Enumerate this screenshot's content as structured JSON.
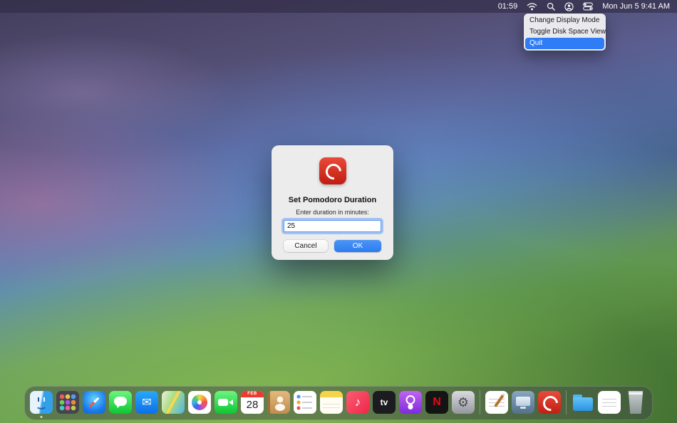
{
  "menu_bar": {
    "timer": "01:59",
    "clock": "Mon Jun 5  9:41 AM",
    "icons": [
      "wifi",
      "spotlight",
      "user-account",
      "control-center"
    ]
  },
  "dropdown_menu": {
    "items": [
      {
        "label": "Change Display Mode",
        "highlighted": false
      },
      {
        "label": "Toggle Disk Space View",
        "highlighted": false
      },
      {
        "label": "Quit",
        "highlighted": true
      }
    ]
  },
  "dialog": {
    "app_icon": "pomodoro-app-icon",
    "title": "Set Pomodoro Duration",
    "message": "Enter duration in minutes:",
    "input_value": "25",
    "cancel_label": "Cancel",
    "ok_label": "OK"
  },
  "dock": {
    "items": [
      {
        "kind": "app",
        "name": "finder",
        "running": true
      },
      {
        "kind": "app",
        "name": "launchpad"
      },
      {
        "kind": "app",
        "name": "safari"
      },
      {
        "kind": "app",
        "name": "messages"
      },
      {
        "kind": "app",
        "name": "mail"
      },
      {
        "kind": "app",
        "name": "maps"
      },
      {
        "kind": "app",
        "name": "photos"
      },
      {
        "kind": "app",
        "name": "facetime"
      },
      {
        "kind": "app",
        "name": "calendar",
        "month": "FEB",
        "day": "28"
      },
      {
        "kind": "app",
        "name": "contacts"
      },
      {
        "kind": "app",
        "name": "reminders"
      },
      {
        "kind": "app",
        "name": "notes"
      },
      {
        "kind": "app",
        "name": "music"
      },
      {
        "kind": "app",
        "name": "tv"
      },
      {
        "kind": "app",
        "name": "podcasts"
      },
      {
        "kind": "app",
        "name": "netflix"
      },
      {
        "kind": "app",
        "name": "settings"
      },
      {
        "kind": "separator"
      },
      {
        "kind": "app",
        "name": "textedit"
      },
      {
        "kind": "app",
        "name": "display"
      },
      {
        "kind": "app",
        "name": "pomodoro"
      },
      {
        "kind": "separator"
      },
      {
        "kind": "app",
        "name": "folder"
      },
      {
        "kind": "app",
        "name": "documents"
      },
      {
        "kind": "app",
        "name": "trash"
      }
    ]
  },
  "colors": {
    "accent": "#2e7cf6",
    "ok_button": "#2e7bf0",
    "menu_highlight": "#2e7cf6",
    "pomodoro_red": "#d02c1e",
    "dialog_background": "#ececec"
  }
}
